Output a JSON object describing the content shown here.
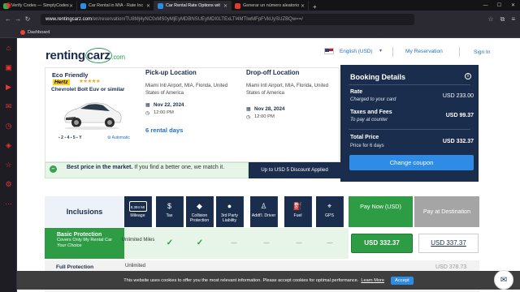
{
  "browser": {
    "tabs": [
      {
        "label": "Verify Codes — SimplyCodes",
        "color": "#2fb34a",
        "active": false
      },
      {
        "label": "Car Rental in MIA - Rate Inc",
        "color": "#2e8ce6",
        "active": false
      },
      {
        "label": "Car Rental Rate Options wit",
        "color": "#2e8ce6",
        "active": true
      },
      {
        "label": "Generar un número aleatorio",
        "color": "#e43b2c",
        "active": false
      }
    ],
    "new_tab": "+",
    "url_host": "www.rentingcarz.com",
    "url_path": "/en/reservation/TU8Mj4yNC0xMS0yMjEyMDBNSUEyMDI0LTExLTI4MTIwMFpFVkUySUZBQw==/",
    "bookmark": "Dashboard"
  },
  "site": {
    "logo_main": "renting",
    "logo_carz": "carz",
    "logo_tld": ".com",
    "language": "English (USD)",
    "my_reservation": "My Reservation",
    "sign_in": "Sign In"
  },
  "car": {
    "category": "Eco Friendly",
    "vendor": "Hertz",
    "stars": "★★★★★",
    "model": "Chevrolet Bolt Euv or similar",
    "seats": "2",
    "bags": "4",
    "doors": "5",
    "transmission": "Automatic"
  },
  "pickup": {
    "title": "Pick-up Location",
    "address": "Miami Intl Airport, MIA, Florida, United States of America",
    "date": "Nov 22, 2024",
    "time": "12:00 PM"
  },
  "dropoff": {
    "title": "Drop-off Location",
    "address": "Miami Intl Airport, MIA, Florida, United States of America",
    "date": "Nov 28, 2024",
    "time": "12:00 PM"
  },
  "rental_days": "6 rental days",
  "booking": {
    "title": "Booking Details",
    "rate_label": "Rate",
    "rate_sub": "Charged to your card",
    "rate_value": "USD 233.00",
    "taxes_label": "Taxes and Fees",
    "taxes_sub": "To pay at counter",
    "taxes_value": "USD 99.37",
    "total_label": "Total Price",
    "total_sub": "Price for 6 days",
    "total_value": "USD 332.37",
    "coupon_button": "Change coupon"
  },
  "promo": {
    "bold": "Best price in the market.",
    "text": " If you find a better one, we match it.",
    "discount": "Up to USD 5 Discount Applied"
  },
  "table": {
    "inclusions": "Inclusions",
    "columns": [
      {
        "icon": "8,384 MI",
        "label": "Mileage"
      },
      {
        "icon": "$",
        "label": "Tax"
      },
      {
        "icon": "◆",
        "label": "Collision Protection"
      },
      {
        "icon": "●",
        "label": "3rd Party Liability"
      },
      {
        "icon": "♙",
        "label": "Addt'l. Driver"
      },
      {
        "icon": "⛽",
        "label": "Fuel"
      },
      {
        "icon": "⌖",
        "label": "GPS"
      }
    ],
    "pay_now": "Pay Now (USD)",
    "pay_destination": "Pay at Destination",
    "row1": {
      "title": "Basic Protection",
      "sub1": "Covers Only My Rental Car",
      "sub2": "Your Choice",
      "mileage": "Unlimited Miles",
      "cells": [
        "✓",
        "✓",
        "—",
        "—",
        "—",
        "—"
      ],
      "price_now": "USD 332.37",
      "price_dest": "USD 337.37"
    },
    "row2": {
      "title": "Full Protection",
      "cell": "Unlimited",
      "price_dest": "USD 378.73"
    }
  },
  "cookie": {
    "text": "This website uses cookies to offer you the most relevant information. Please accept cookies for optimal performance.",
    "link": "Learn More",
    "button": "Accept"
  }
}
